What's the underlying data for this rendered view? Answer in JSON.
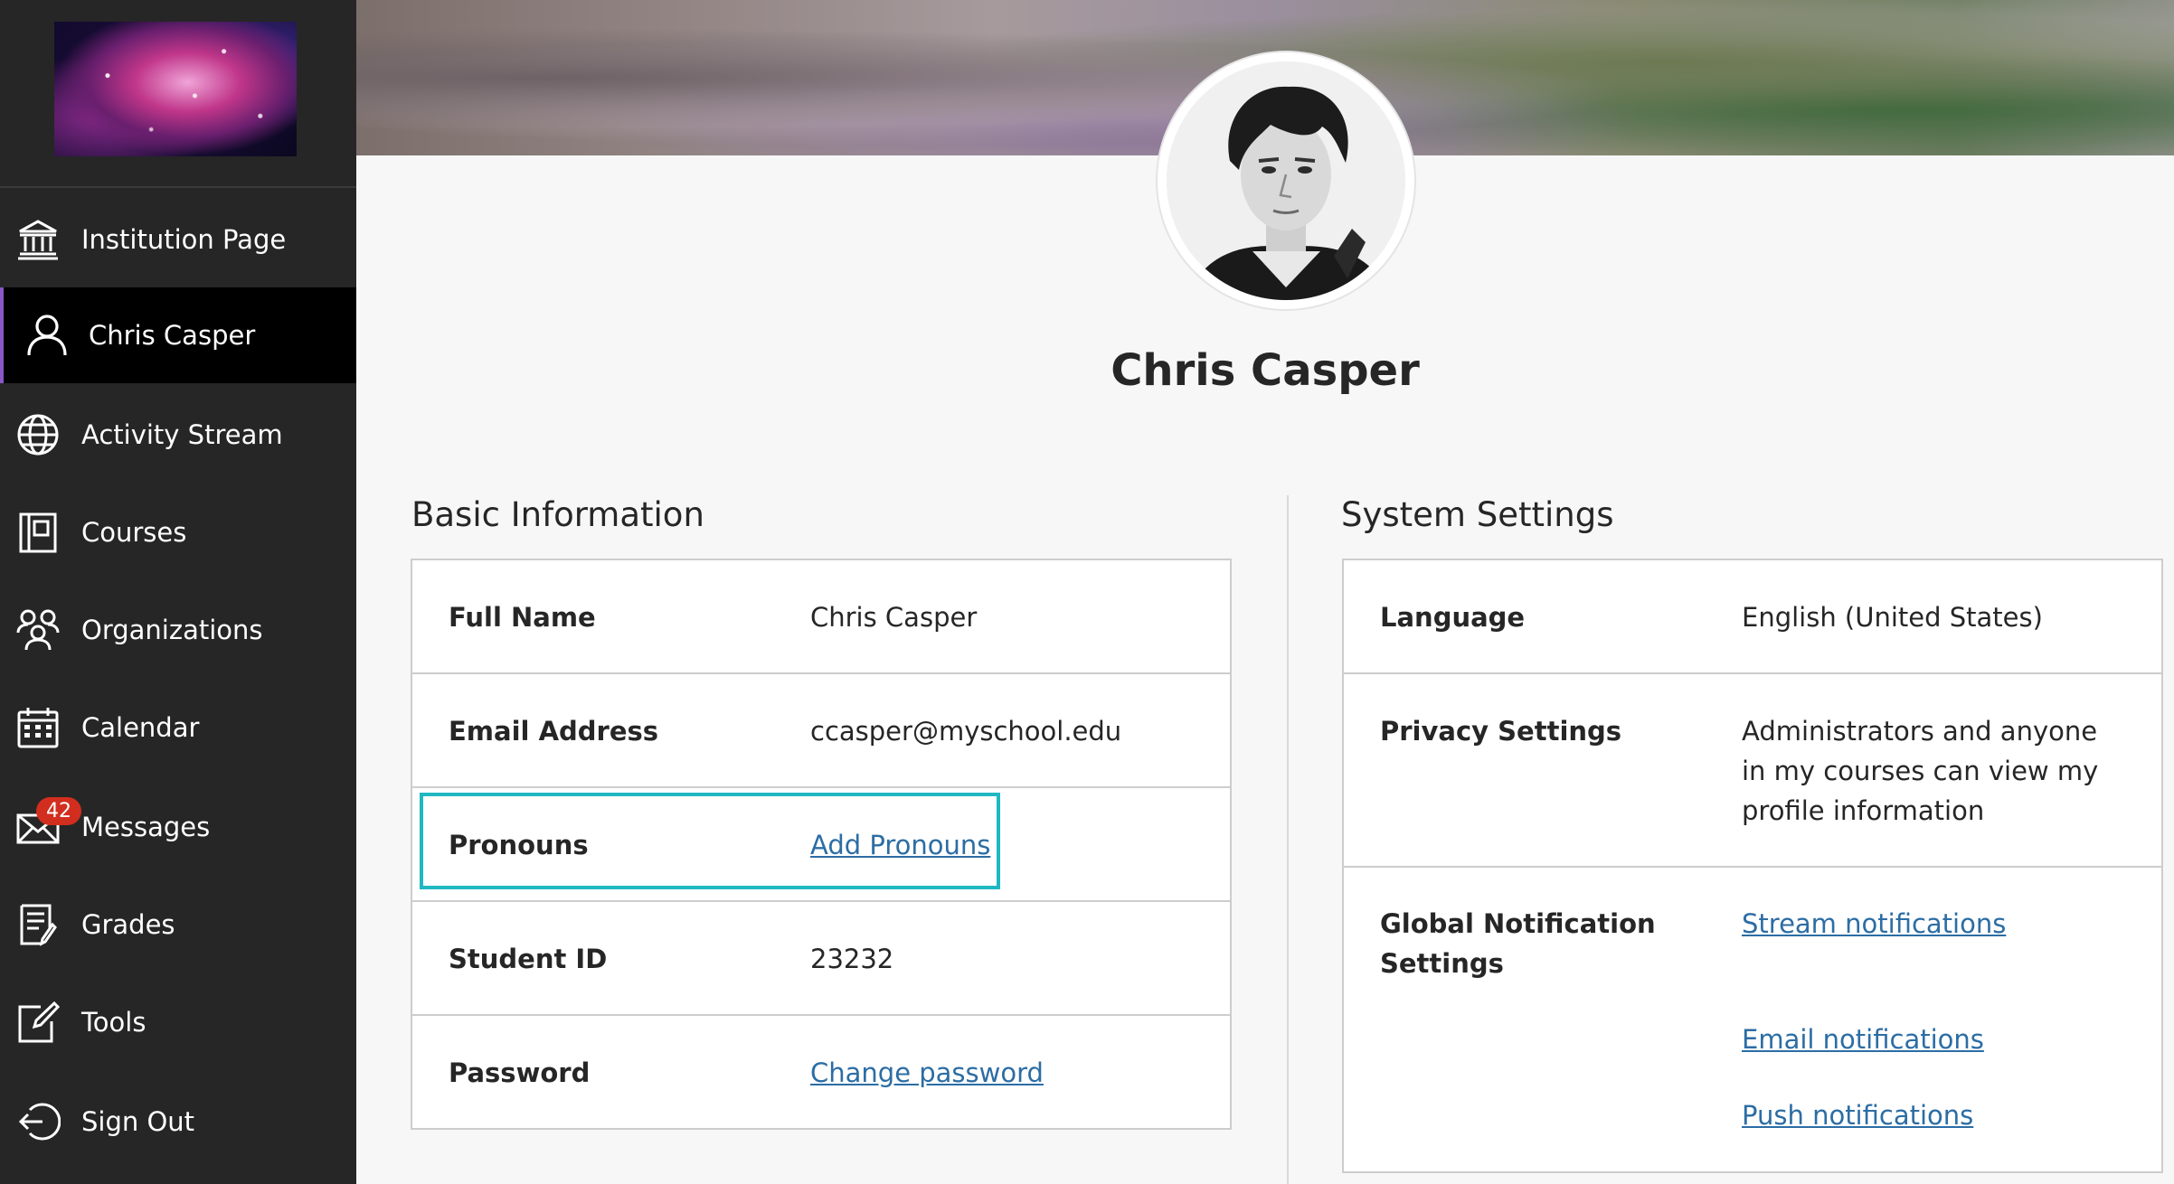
{
  "sidebar": {
    "logo": "galaxy-logo",
    "items": [
      {
        "label": "Institution Page",
        "icon": "institution-icon"
      },
      {
        "label": "Chris Casper",
        "icon": "user-icon"
      },
      {
        "label": "Activity Stream",
        "icon": "globe-icon"
      },
      {
        "label": "Courses",
        "icon": "courses-icon"
      },
      {
        "label": "Organizations",
        "icon": "organizations-icon"
      },
      {
        "label": "Calendar",
        "icon": "calendar-icon"
      },
      {
        "label": "Messages",
        "icon": "envelope-icon",
        "badge": "42"
      },
      {
        "label": "Grades",
        "icon": "grades-icon"
      },
      {
        "label": "Tools",
        "icon": "tools-icon"
      },
      {
        "label": "Sign Out",
        "icon": "sign-out-icon"
      }
    ],
    "active_index": 1,
    "accent_color": "#8b56c7",
    "badge_color": "#d22e1f"
  },
  "profile": {
    "name": "Chris Casper"
  },
  "basic_info": {
    "title": "Basic Information",
    "rows": [
      {
        "label": "Full Name",
        "value": "Chris Casper"
      },
      {
        "label": "Email Address",
        "value": "ccasper@myschool.edu"
      },
      {
        "label": "Pronouns",
        "value": "Add Pronouns"
      },
      {
        "label": "Student ID",
        "value": "23232"
      },
      {
        "label": "Password",
        "value": "Change password"
      }
    ]
  },
  "system_settings": {
    "title": "System Settings",
    "rows": [
      {
        "label": "Language",
        "value": "English (United States)"
      },
      {
        "label": "Privacy Settings",
        "value_lines": [
          "Administrators and anyone",
          "in my courses can view my",
          "profile information"
        ]
      },
      {
        "label_lines": [
          "Global Notification",
          "Settings"
        ],
        "links": [
          "Stream notifications",
          "Email notifications",
          "Push notifications"
        ]
      }
    ]
  },
  "colors": {
    "link": "#2c6da4",
    "highlight": "#1fb8c2"
  }
}
